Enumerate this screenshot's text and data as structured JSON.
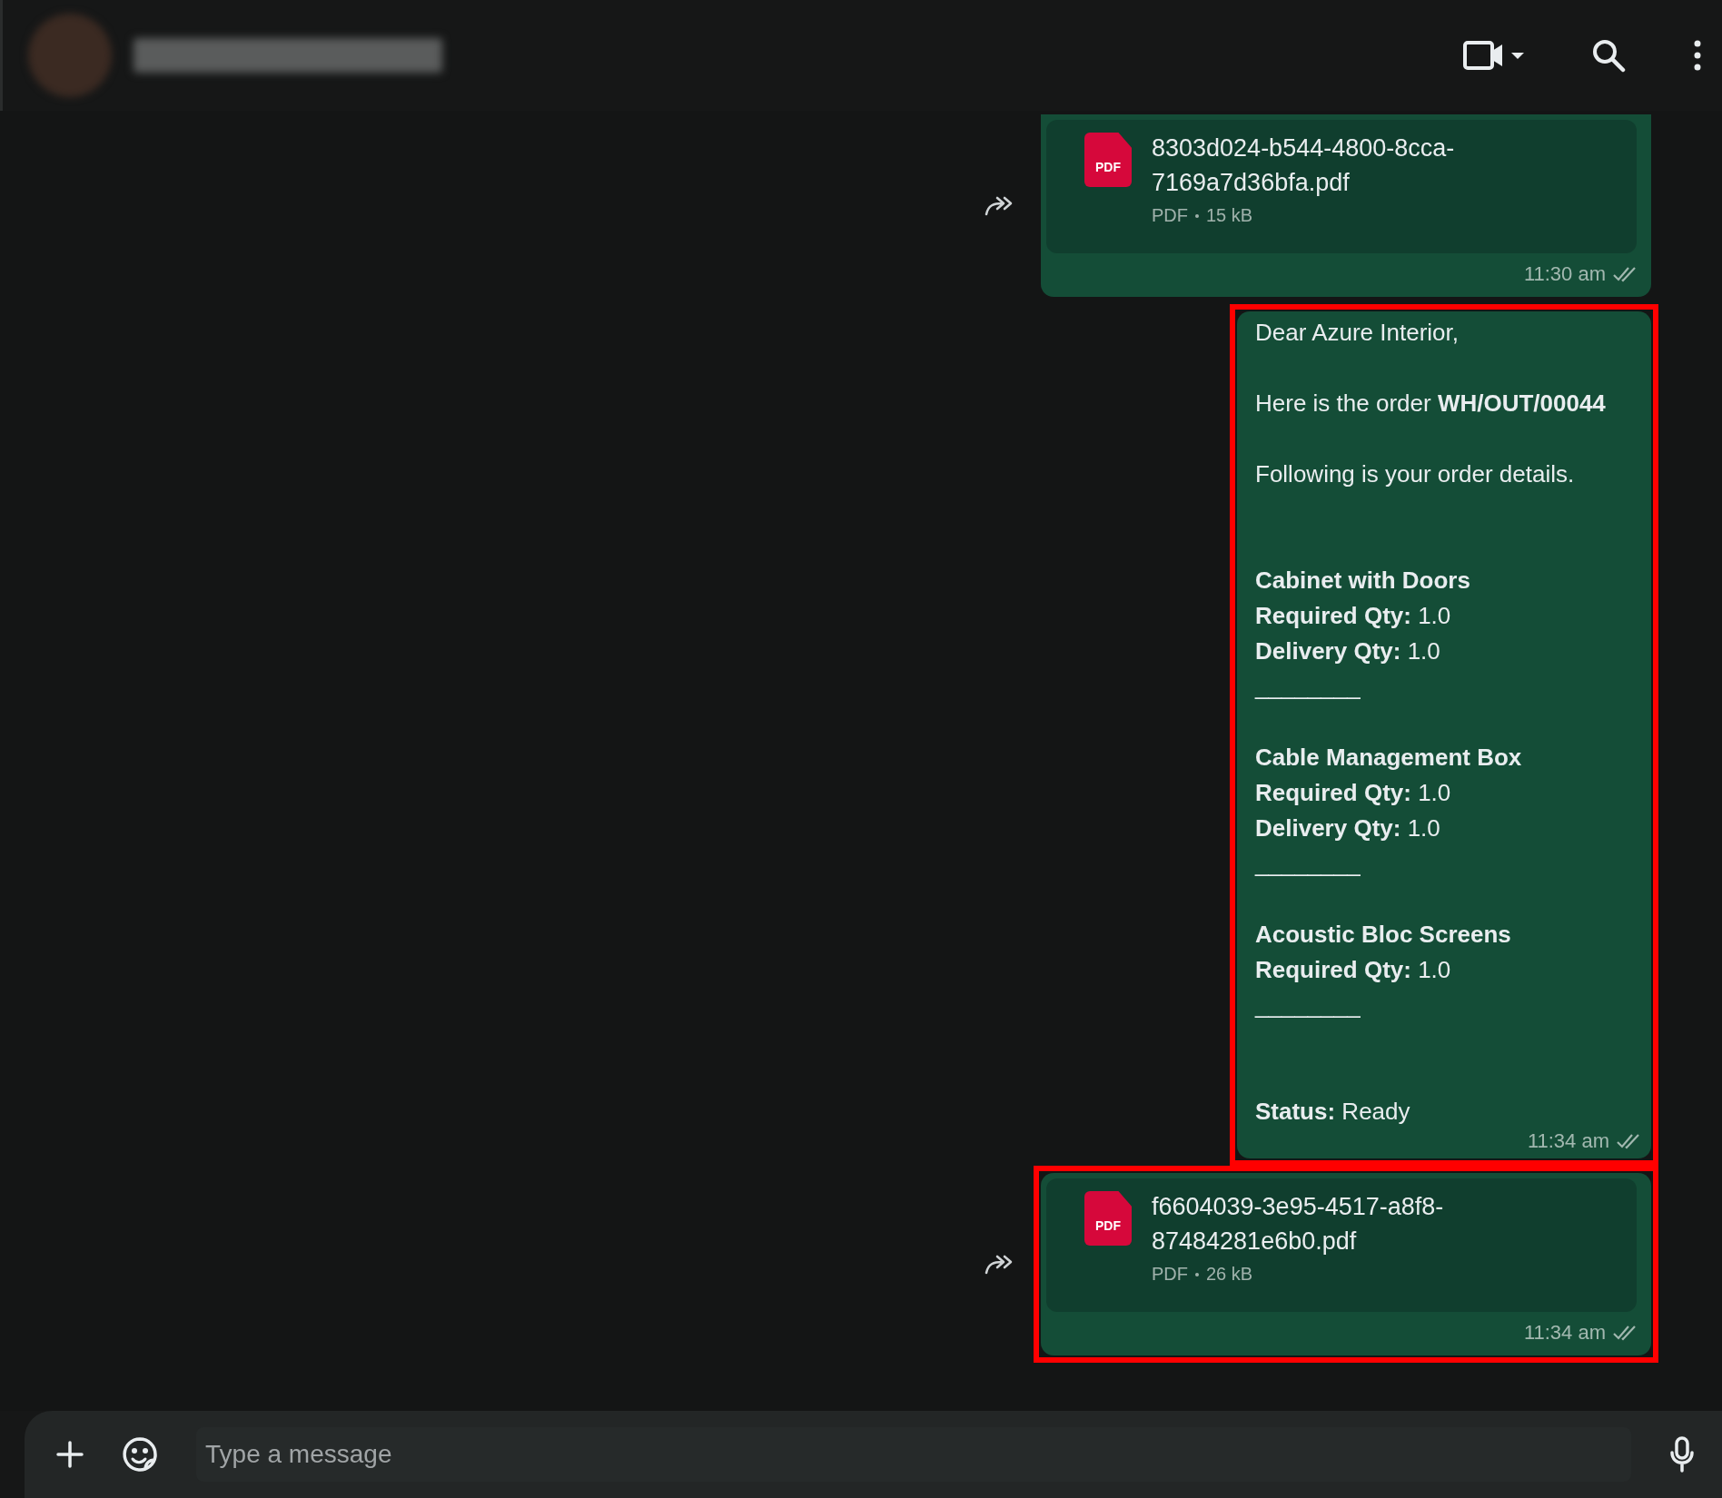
{
  "messages": [
    {
      "kind": "document",
      "icon_label": "PDF",
      "file_name": "8303d024-b544-4800-8cca-7169a7d36bfa.pdf",
      "file_type": "PDF",
      "file_size": "15 kB",
      "time": "11:30 am",
      "highlighted": false,
      "cut_top": true
    },
    {
      "kind": "text",
      "text": "Dear Azure Interior,\n\nHere is the order **WH/OUT/00044**\n\nFollowing is your order details.\n\n\n**Cabinet with Doors**\n**Required Qty:** 1.0\n**Delivery Qty:** 1.0\n________\n\n**Cable Management Box**\n**Required Qty:** 1.0\n**Delivery Qty:** 1.0\n________\n\n**Acoustic Bloc Screens**\n**Required Qty:** 1.0\n________\n\n\n**Status:** Ready",
      "time": "11:34 am",
      "highlighted": true,
      "cut_top": false
    },
    {
      "kind": "document",
      "icon_label": "PDF",
      "file_name": "f6604039-3e95-4517-a8f8-87484281e6b0.pdf",
      "file_type": "PDF",
      "file_size": "26 kB",
      "time": "11:34 am",
      "highlighted": true,
      "cut_top": false
    }
  ],
  "composer": {
    "placeholder": "Type a message"
  }
}
